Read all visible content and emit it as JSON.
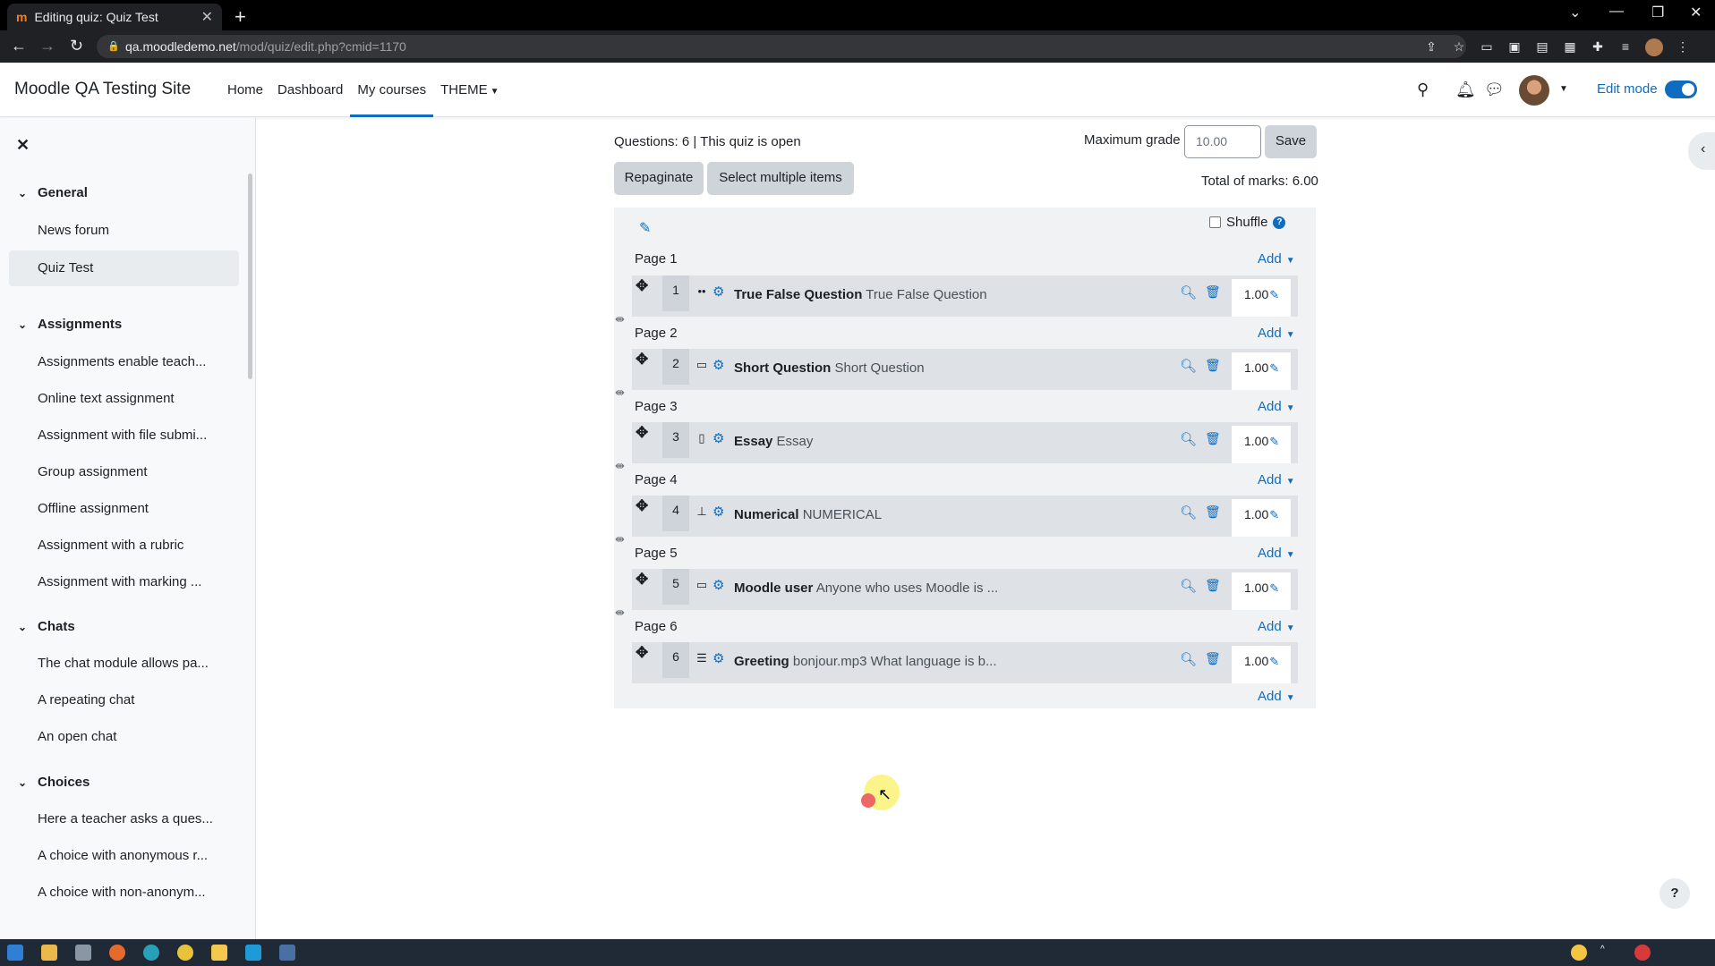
{
  "browser": {
    "tab_title": "Editing quiz: Quiz Test",
    "tab_favicon": "m",
    "url_host": "qa.moodledemo.net",
    "url_path": "/mod/quiz/edit.php?cmid=1170"
  },
  "navbar": {
    "brand": "Moodle QA Testing Site",
    "items": [
      "Home",
      "Dashboard",
      "My courses",
      "THEME"
    ],
    "edit_mode_label": "Edit mode"
  },
  "drawer": {
    "sections": [
      {
        "title": "General",
        "items": [
          "News forum",
          "Quiz Test"
        ]
      },
      {
        "title": "Assignments",
        "items": [
          "Assignments enable teach...",
          "Online text assignment",
          "Assignment with file submi...",
          "Group assignment",
          "Offline assignment",
          "Assignment with a rubric",
          "Assignment with marking ..."
        ]
      },
      {
        "title": "Chats",
        "items": [
          "The chat module allows pa...",
          "A repeating chat",
          "An open chat"
        ]
      },
      {
        "title": "Choices",
        "items": [
          "Here a teacher asks a ques...",
          "A choice with anonymous r...",
          "A choice with non-anonym..."
        ]
      }
    ]
  },
  "quiz": {
    "info": "Questions: 6 | This quiz is open",
    "max_grade_label": "Maximum grade",
    "max_grade_value": "10.00",
    "save_label": "Save",
    "repaginate_label": "Repaginate",
    "select_multiple_label": "Select multiple items",
    "total_marks": "Total of marks: 6.00",
    "shuffle_label": "Shuffle",
    "add_label": "Add",
    "pages": [
      "Page 1",
      "Page 2",
      "Page 3",
      "Page 4",
      "Page 5",
      "Page 6"
    ],
    "questions": [
      {
        "num": "1",
        "type_icon": "truefalse-icon",
        "name": "True False Question",
        "text": "True False Question",
        "mark": "1.00"
      },
      {
        "num": "2",
        "type_icon": "shortanswer-icon",
        "name": "Short Question",
        "text": "Short Question",
        "mark": "1.00"
      },
      {
        "num": "3",
        "type_icon": "essay-icon",
        "name": "Essay",
        "text": "Essay",
        "mark": "1.00"
      },
      {
        "num": "4",
        "type_icon": "numerical-icon",
        "name": "Numerical",
        "text": "NUMERICAL",
        "mark": "1.00"
      },
      {
        "num": "5",
        "type_icon": "shortanswer-icon",
        "name": "Moodle user",
        "text": "Anyone who uses Moodle is ...",
        "mark": "1.00"
      },
      {
        "num": "6",
        "type_icon": "multichoice-icon",
        "name": "Greeting",
        "text": "bonjour.mp3 What language is b...",
        "mark": "1.00"
      }
    ]
  },
  "colors": {
    "accent": "#0f6cbf",
    "tab_bg": "#000000",
    "drawer_bg": "#f8f9fa"
  }
}
